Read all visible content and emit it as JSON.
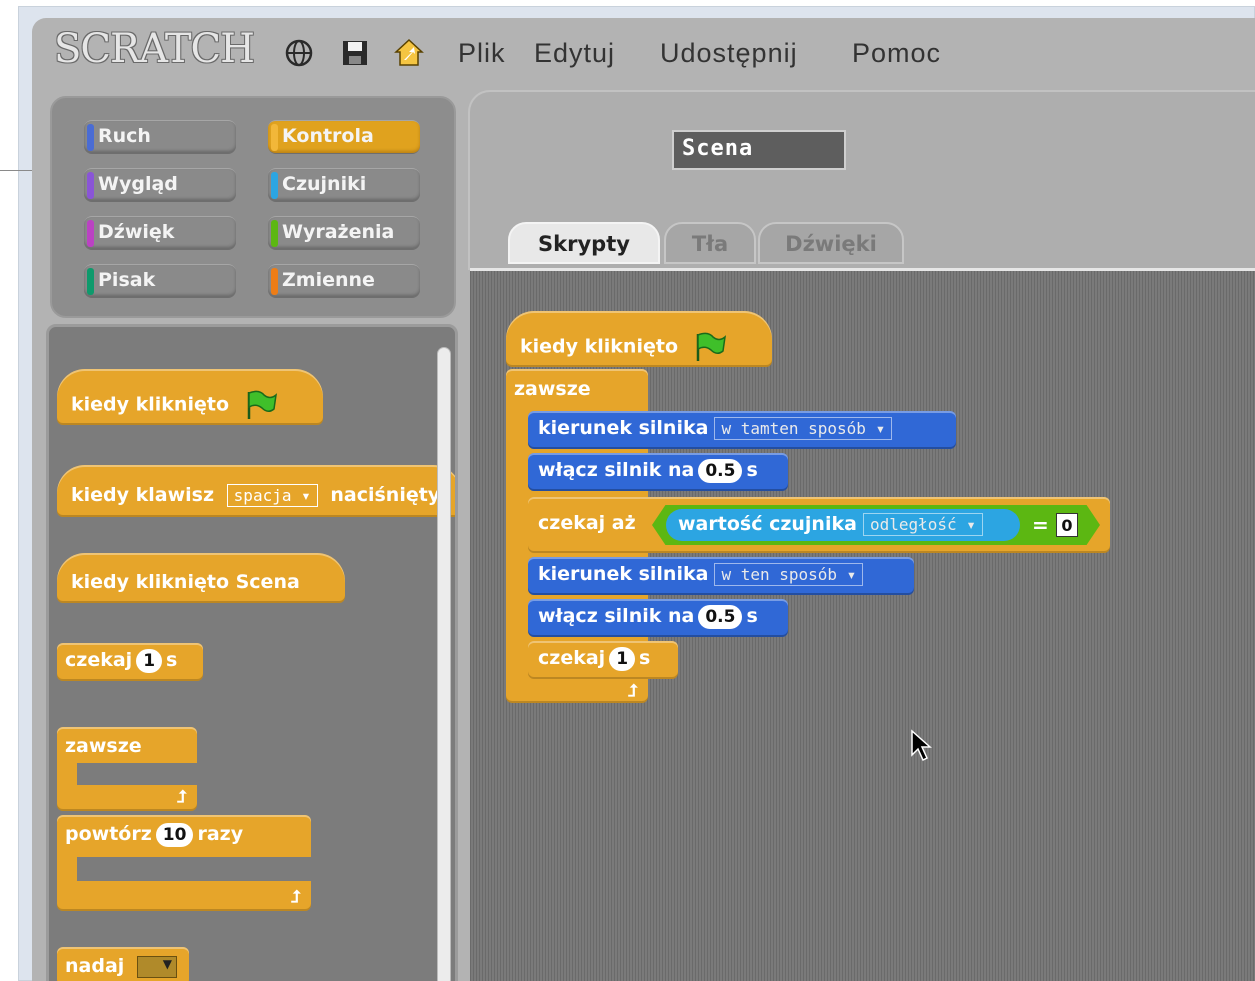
{
  "app": {
    "logo": "SCRATCH"
  },
  "menubar": {
    "items": [
      "Plik",
      "Edytuj",
      "Udostępnij",
      "Pomoc"
    ]
  },
  "categories": [
    {
      "label": "Ruch",
      "color": "#4a6cd4"
    },
    {
      "label": "Kontrola",
      "color": "#e1a91a"
    },
    {
      "label": "Wygląd",
      "color": "#8a55d7"
    },
    {
      "label": "Czujniki",
      "color": "#2ca5e2"
    },
    {
      "label": "Dźwięk",
      "color": "#bb42c3"
    },
    {
      "label": "Wyrażenia",
      "color": "#5cb712"
    },
    {
      "label": "Pisak",
      "color": "#0e9a6c"
    },
    {
      "label": "Zmienne",
      "color": "#ee7d16"
    }
  ],
  "selected_category": "Kontrola",
  "palette": {
    "when_flag": "kiedy kliknięto",
    "when_key": "kiedy klawisz",
    "when_key_value": "spacja",
    "when_key_suffix": "naciśnięty",
    "when_stage_clicked": "kiedy kliknięto Scena",
    "wait": "czekaj",
    "wait_value": "1",
    "wait_unit": "s",
    "forever": "zawsze",
    "repeat": "powtórz",
    "repeat_value": "10",
    "repeat_unit": "razy",
    "broadcast": "nadaj"
  },
  "sprite": {
    "name": "Scena"
  },
  "tabs": [
    "Skrypty",
    "Tła",
    "Dźwięki"
  ],
  "active_tab": "Skrypty",
  "script": {
    "hat": "kiedy kliknięto",
    "forever": "zawsze",
    "motor_dir_label": "kierunek silnika",
    "motor_dir_1": "w tamten sposób",
    "motor_on_label": "włącz silnik na",
    "motor_on_1": "0.5",
    "motor_unit": "s",
    "wait_until": "czekaj aż",
    "sensor_label": "wartość czujnika",
    "sensor_value": "odległość",
    "equals": "=",
    "compare_value": "0",
    "motor_dir_2": "w ten sposób",
    "motor_on_2": "0.5",
    "wait": "czekaj",
    "wait_value": "1",
    "wait_unit": "s"
  },
  "colors": {
    "control": "#e6a52a",
    "motion": "#3068d6",
    "sensing": "#2ca5e2",
    "operators": "#5cb712"
  }
}
